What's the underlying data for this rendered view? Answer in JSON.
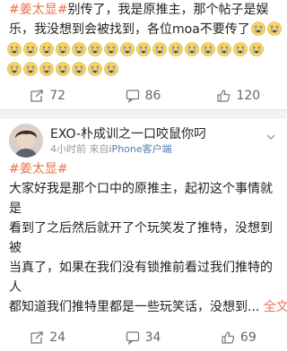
{
  "post1": {
    "line1_topic": "#姜太显#",
    "line1_text": "别传了，我是原推主，那个帖子是娱",
    "line2_text": "乐，我没想到会被找到，各位moa不要传了",
    "emoji_name": "crying-face-icon",
    "stats": {
      "repost": "72",
      "comment": "86",
      "like": "120"
    }
  },
  "post2": {
    "username": "EXO-朴成训之一口咬鼠你叼",
    "time": "4小时前",
    "source_prefix": "来自",
    "source_device": "iPhone客户端",
    "topic": "#姜太显#",
    "lines": [
      "大家好我是那个口中的原推主，起初这个事情就是",
      "看到了之后然后就开了个玩笑发了推特，没想到被",
      "当真了，如果在我们没有锁推前看过我们推特的人",
      "都知道我们推特里都是一些玩笑话，没想到..."
    ],
    "fulltext_label": "全文",
    "stats": {
      "repost": "24",
      "comment": "34",
      "like": "69"
    }
  },
  "colors": {
    "topic": "#eb7350",
    "link": "#507daf",
    "divider": "#f2f2f2"
  }
}
